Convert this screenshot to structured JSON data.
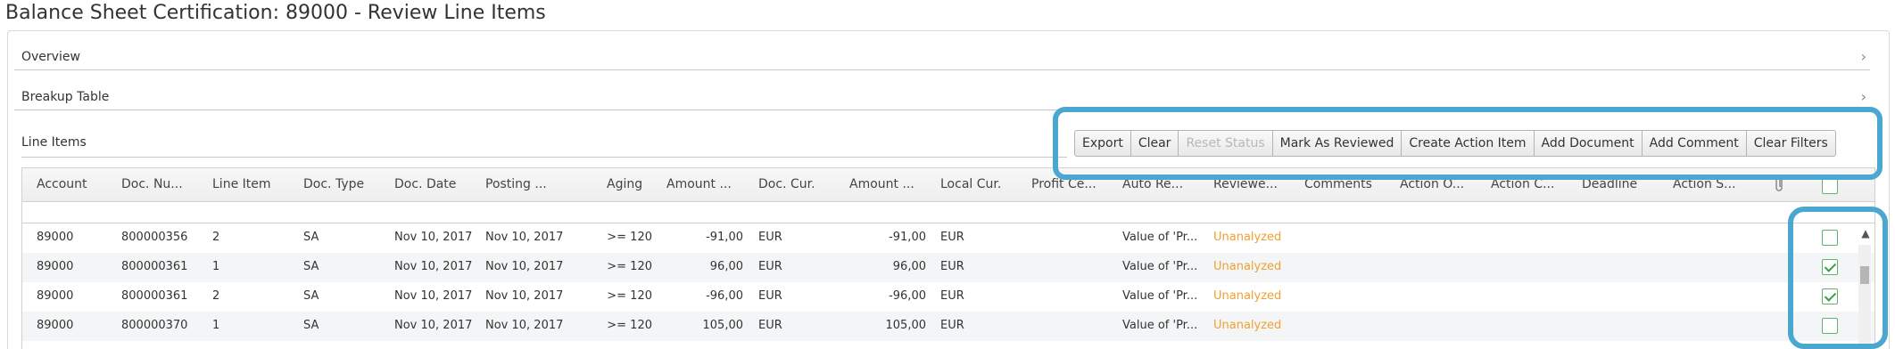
{
  "page": {
    "title": "Balance Sheet Certification: 89000 - Review Line Items"
  },
  "sections": {
    "overview": {
      "label": "Overview"
    },
    "breakup": {
      "label": "Breakup Table"
    },
    "line_items": {
      "label": "Line Items"
    }
  },
  "icons": {
    "chevron": "chevron-right-icon",
    "attachment": "paperclip-icon",
    "checkmark": "checkmark-icon",
    "scroll_up": "caret-up-icon"
  },
  "colors": {
    "highlight": "#4aa8d0",
    "status_unanalyzed": "#f0a030",
    "checkbox": "#5fb36a"
  },
  "toolbar": {
    "export": "Export",
    "clear": "Clear",
    "reset_status": "Reset Status",
    "mark_as_reviewed": "Mark As Reviewed",
    "create_action_item": "Create Action Item",
    "add_document": "Add Document",
    "add_comment": "Add Comment",
    "clear_filters": "Clear Filters"
  },
  "grid": {
    "columns": [
      "Account",
      "Doc. Nu...",
      "Line Item",
      "Doc. Type",
      "Doc. Date",
      "Posting ...",
      "Aging",
      "Amount ...",
      "Doc. Cur.",
      "Amount ...",
      "Local Cur.",
      "Profit Ce...",
      "Auto Re...",
      "Reviewe...",
      "Comments",
      "Action O...",
      "Action C...",
      "Deadline",
      "Action S..."
    ],
    "rows": [
      {
        "account": "89000",
        "doc_number": "800000356",
        "line_item": "2",
        "doc_type": "SA",
        "doc_date": "Nov 10, 2017",
        "posting_date": "Nov 10, 2017",
        "aging": ">= 120",
        "amount_doc": "-91,00",
        "doc_currency": "EUR",
        "amount_local": "-91,00",
        "local_currency": "EUR",
        "auto_reviewed": "Value of 'Pr...",
        "reviewed": "Unanalyzed",
        "checked": false
      },
      {
        "account": "89000",
        "doc_number": "800000361",
        "line_item": "1",
        "doc_type": "SA",
        "doc_date": "Nov 10, 2017",
        "posting_date": "Nov 10, 2017",
        "aging": ">= 120",
        "amount_doc": "96,00",
        "doc_currency": "EUR",
        "amount_local": "96,00",
        "local_currency": "EUR",
        "auto_reviewed": "Value of 'Pr...",
        "reviewed": "Unanalyzed",
        "checked": true
      },
      {
        "account": "89000",
        "doc_number": "800000361",
        "line_item": "2",
        "doc_type": "SA",
        "doc_date": "Nov 10, 2017",
        "posting_date": "Nov 10, 2017",
        "aging": ">= 120",
        "amount_doc": "-96,00",
        "doc_currency": "EUR",
        "amount_local": "-96,00",
        "local_currency": "EUR",
        "auto_reviewed": "Value of 'Pr...",
        "reviewed": "Unanalyzed",
        "checked": true
      },
      {
        "account": "89000",
        "doc_number": "800000370",
        "line_item": "1",
        "doc_type": "SA",
        "doc_date": "Nov 10, 2017",
        "posting_date": "Nov 10, 2017",
        "aging": ">= 120",
        "amount_doc": "105,00",
        "doc_currency": "EUR",
        "amount_local": "105,00",
        "local_currency": "EUR",
        "auto_reviewed": "Value of 'Pr...",
        "reviewed": "Unanalyzed",
        "checked": false
      }
    ]
  }
}
